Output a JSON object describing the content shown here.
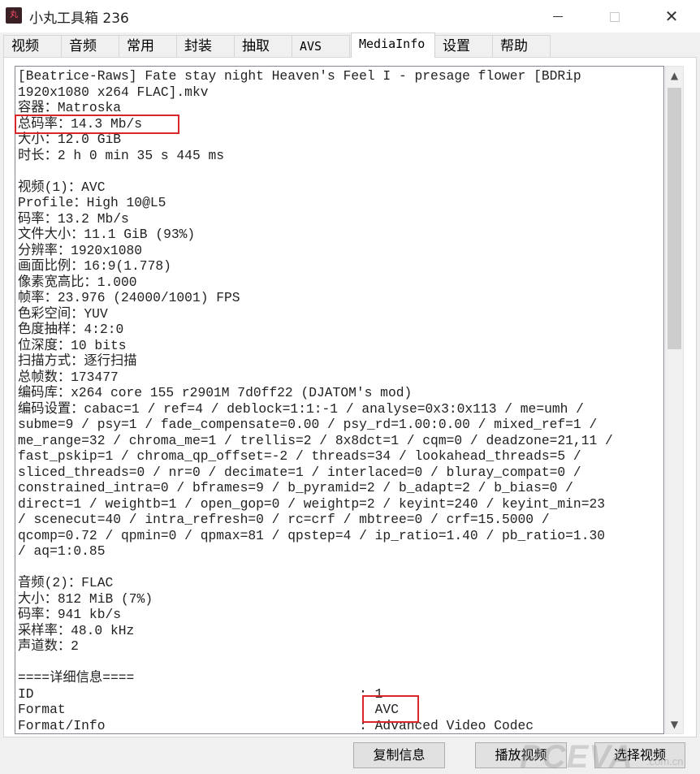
{
  "window": {
    "icon_label": "丸",
    "title": "小丸工具箱 236",
    "minimize_label": "",
    "maximize_label": "",
    "close_label": "✕"
  },
  "tabs": [
    {
      "label": "视频"
    },
    {
      "label": "音频"
    },
    {
      "label": "常用"
    },
    {
      "label": "封装"
    },
    {
      "label": "抽取"
    },
    {
      "label": "AVS"
    },
    {
      "label": "MediaInfo",
      "active": true
    },
    {
      "label": "设置"
    },
    {
      "label": "帮助"
    }
  ],
  "mediainfo": {
    "lines": [
      "[Beatrice-Raws] Fate stay night Heaven's Feel I - presage flower [BDRip",
      "1920x1080 x264 FLAC].mkv",
      "容器：Matroska",
      "总码率：14.3 Mb/s",
      "大小：12.0 GiB",
      "时长：2 h 0 min 35 s 445 ms",
      "",
      "视频(1)：AVC",
      "Profile：High 10@L5",
      "码率：13.2 Mb/s",
      "文件大小：11.1 GiB (93%)",
      "分辨率：1920x1080",
      "画面比例：16:9(1.778)",
      "像素宽高比：1.000",
      "帧率：23.976 (24000/1001) FPS",
      "色彩空间：YUV",
      "色度抽样：4:2:0",
      "位深度：10 bits",
      "扫描方式：逐行扫描",
      "总帧数：173477",
      "编码库：x264 core 155 r2901M 7d0ff22 (DJATOM's mod)",
      "编码设置：cabac=1 / ref=4 / deblock=1:1:-1 / analyse=0x3:0x113 / me=umh /",
      "subme=9 / psy=1 / fade_compensate=0.00 / psy_rd=1.00:0.00 / mixed_ref=1 /",
      "me_range=32 / chroma_me=1 / trellis=2 / 8x8dct=1 / cqm=0 / deadzone=21,11 /",
      "fast_pskip=1 / chroma_qp_offset=-2 / threads=34 / lookahead_threads=5 /",
      "sliced_threads=0 / nr=0 / decimate=1 / interlaced=0 / bluray_compat=0 /",
      "constrained_intra=0 / bframes=9 / b_pyramid=2 / b_adapt=2 / b_bias=0 /",
      "direct=1 / weightb=1 / open_gop=0 / weightp=2 / keyint=240 / keyint_min=23",
      "/ scenecut=40 / intra_refresh=0 / rc=crf / mbtree=0 / crf=15.5000 /",
      "qcomp=0.72 / qpmin=0 / qpmax=81 / qpstep=4 / ip_ratio=1.40 / pb_ratio=1.30",
      "/ aq=1:0.85",
      "",
      "音频(2)：FLAC",
      "大小：812 MiB (7%)",
      "码率：941 kb/s",
      "采样率：48.0 kHz",
      "声道数：2",
      "",
      "====详细信息====",
      "ID                                         : 1",
      "Format                                     : AVC",
      "Format/Info                                : Advanced Video Codec"
    ]
  },
  "scrollbar": {
    "up_arrow": "▲",
    "down_arrow": "▼"
  },
  "buttons": {
    "copy_info": "复制信息",
    "play_video": "播放视频",
    "select_video": "选择视频"
  },
  "watermark": {
    "main": "PCEVA",
    "sub": ".com.cn"
  }
}
